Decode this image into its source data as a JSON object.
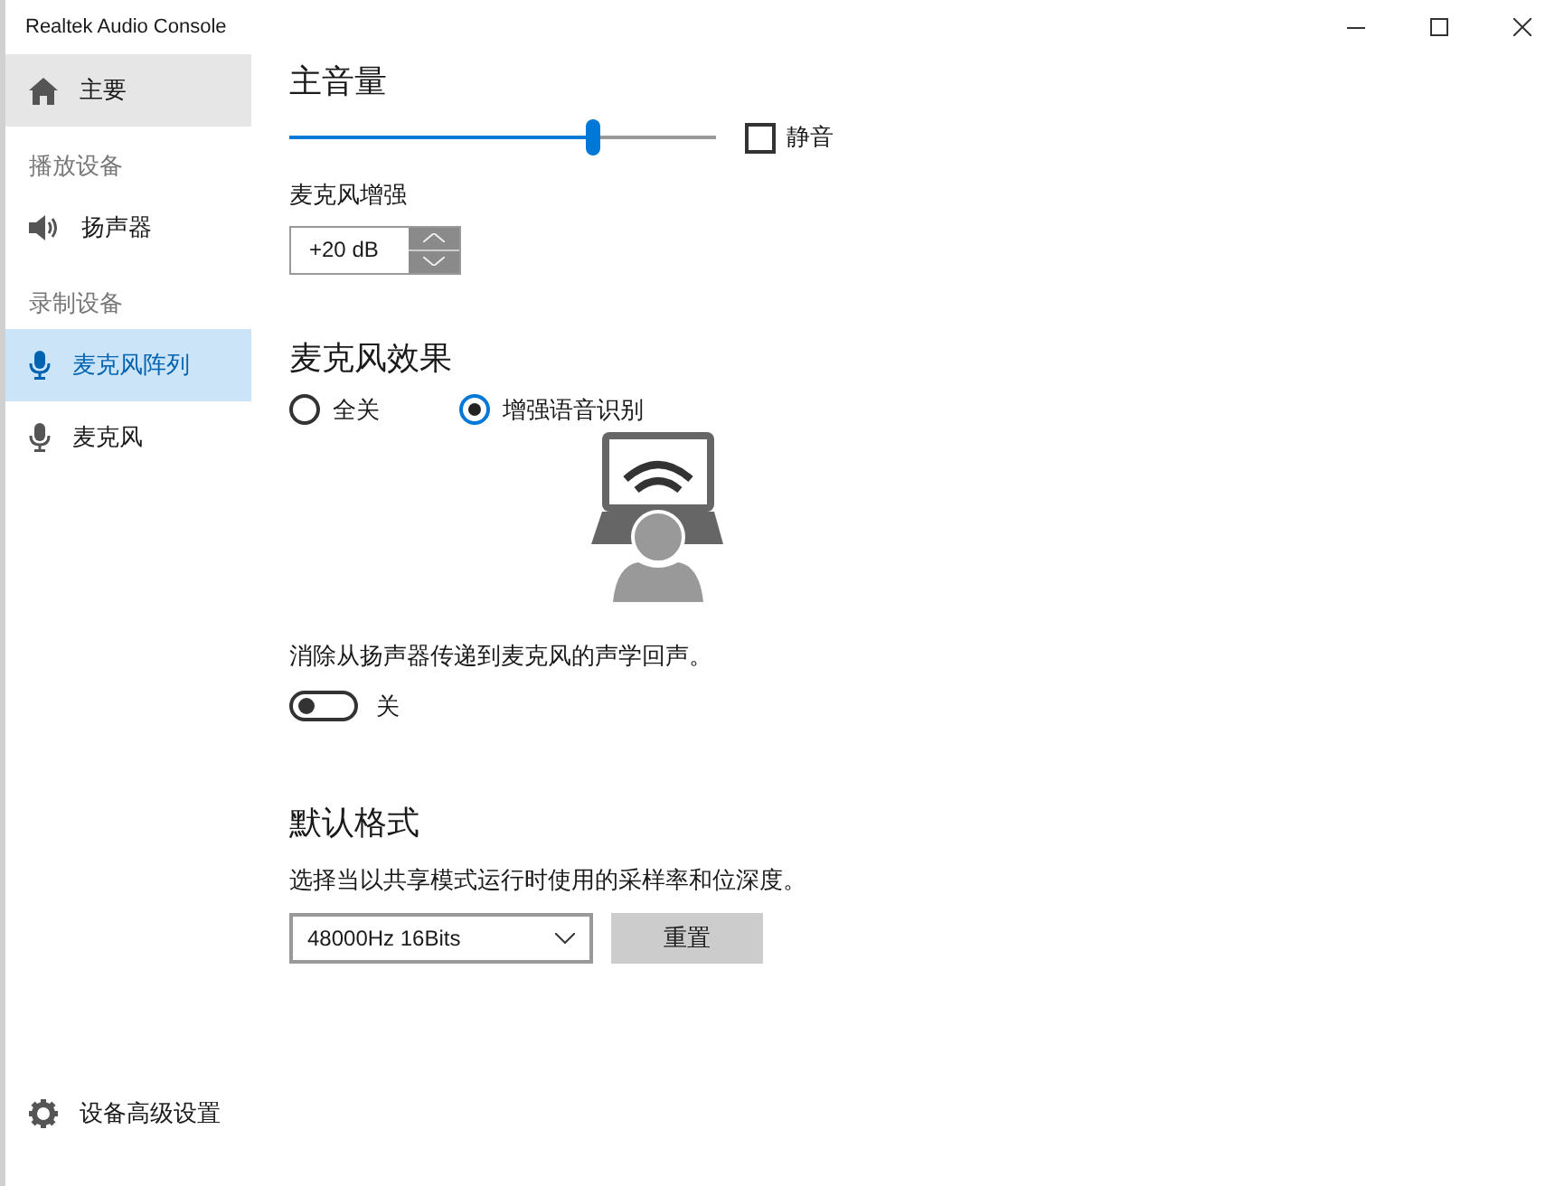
{
  "window": {
    "title": "Realtek Audio Console"
  },
  "sidebar": {
    "items": [
      {
        "kind": "home",
        "label": "主要",
        "selected": false,
        "hover": true
      },
      {
        "kind": "header",
        "label": "播放设备"
      },
      {
        "kind": "speaker",
        "label": "扬声器",
        "selected": false,
        "hover": false
      },
      {
        "kind": "header",
        "label": "录制设备"
      },
      {
        "kind": "mic",
        "label": "麦克风阵列",
        "selected": true,
        "hover": false
      },
      {
        "kind": "mic",
        "label": "麦克风",
        "selected": false,
        "hover": false
      }
    ],
    "footer": {
      "label": "设备高级设置"
    }
  },
  "main": {
    "volume": {
      "title": "主音量",
      "level": 0.71,
      "mute": {
        "label": "静音",
        "checked": false
      }
    },
    "boost": {
      "label": "麦克风增强",
      "value": "+20 dB"
    },
    "effects": {
      "title": "麦克风效果",
      "options": [
        {
          "label": "全关",
          "selected": false
        },
        {
          "label": "增强语音识别",
          "selected": true
        }
      ]
    },
    "echo": {
      "description": "消除从扬声器传递到麦克风的声学回声。",
      "on": false,
      "state_label": "关"
    },
    "format": {
      "title": "默认格式",
      "description": "选择当以共享模式运行时使用的采样率和位深度。",
      "value": "48000Hz 16Bits",
      "reset": "重置"
    }
  }
}
